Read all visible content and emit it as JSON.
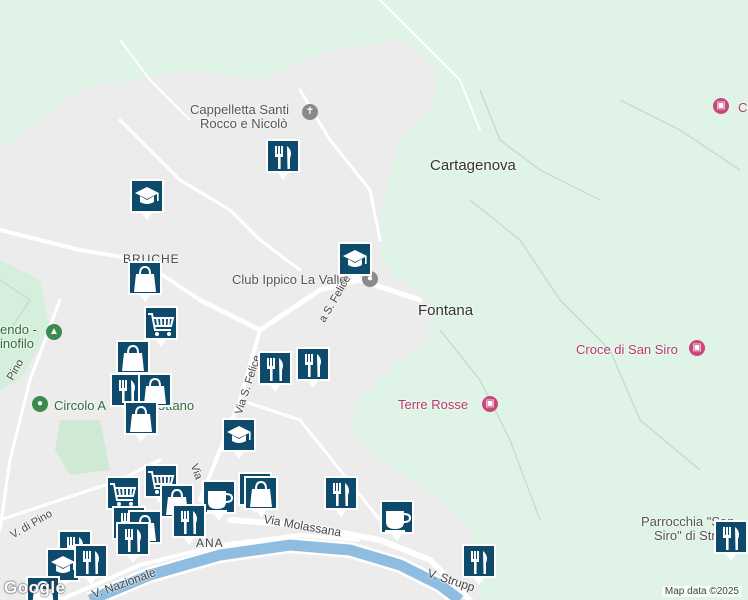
{
  "map": {
    "places": {
      "cartagenova": "Cartagenova",
      "fontana": "Fontana",
      "bruche": "BRUCHE"
    },
    "pois": {
      "cappelletta_line1": "Cappelletta Santi",
      "cappelletta_line2": "Rocco e Nicolò",
      "club_ippico": "Club Ippico La Valle",
      "croce_san_siro": "Croce di San Siro",
      "terre_rosse": "Terre Rosse",
      "circolo": "Circolo A",
      "circolo_tail": "ottano",
      "parrocchia_line1": "Parrocchia \"San",
      "parrocchia_line2": "Siro\" di Stru",
      "edge_left_line1": "endo -",
      "edge_left_line2": "inofilo",
      "edge_pink_right": "C"
    },
    "roads": {
      "via_s_felice_upper": "a S. Felice",
      "via_s_felice_lower": "Via S. Felice",
      "via_di_pino_top": "Pino",
      "via_di_pino": "V. di Pino",
      "via_molassana": "Via Molassana",
      "v_nazionale": "V. Nazionale",
      "v_struppa": "V. Strupp",
      "via_vertical": "Via",
      "ana_fragment": "ANA"
    },
    "icons": {
      "restaurant": "restaurant-icon",
      "school": "school-icon",
      "shopping_bag": "shopping-bag-icon",
      "shopping_cart": "shopping-cart-icon",
      "cafe": "cafe-icon",
      "church": "church-icon",
      "camera": "camera-icon",
      "tree": "tree-icon"
    },
    "colors": {
      "park": "#dff3e6",
      "urban": "#ececec",
      "river": "#8fbde0",
      "marker": "#0d4a6b"
    },
    "attribution": "Map data ©2025",
    "logo": "Google"
  }
}
